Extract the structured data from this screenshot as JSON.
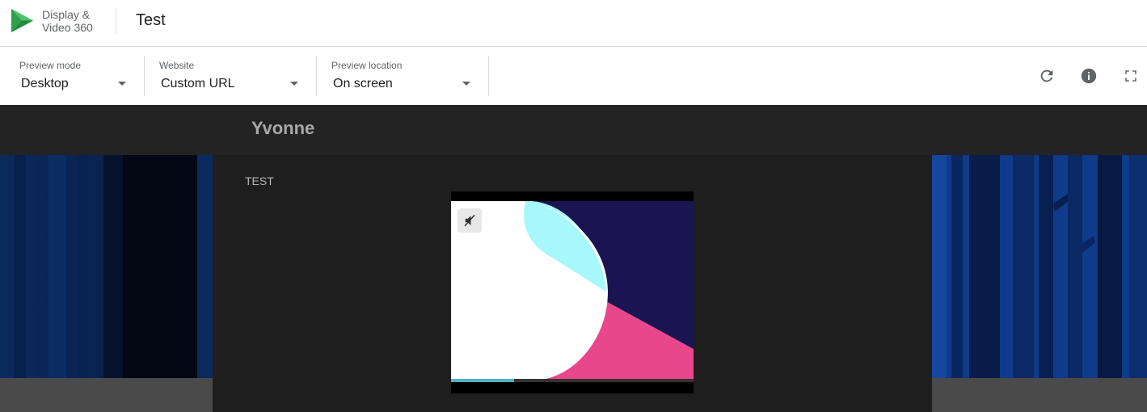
{
  "app": {
    "brand_line1": "Display &",
    "brand_line2": "Video 360",
    "title": "Test"
  },
  "toolbar": {
    "preview_mode": {
      "label": "Preview mode",
      "value": "Desktop"
    },
    "website": {
      "label": "Website",
      "value": "Custom URL"
    },
    "preview_location": {
      "label": "Preview location",
      "value": "On screen"
    },
    "icons": [
      "refresh-icon",
      "info-icon",
      "fullscreen-icon"
    ]
  },
  "preview": {
    "site_name": "Yvonne",
    "section_label": "TEST",
    "ad": {
      "video_progress": 0.26,
      "muted": true
    }
  },
  "colors": {
    "brand_green": "#34a853",
    "ad_navy": "#1a1452",
    "ad_cyan": "#a6f8fb",
    "ad_pink": "#e8488b",
    "ad_progress": "#4fb3c8"
  }
}
